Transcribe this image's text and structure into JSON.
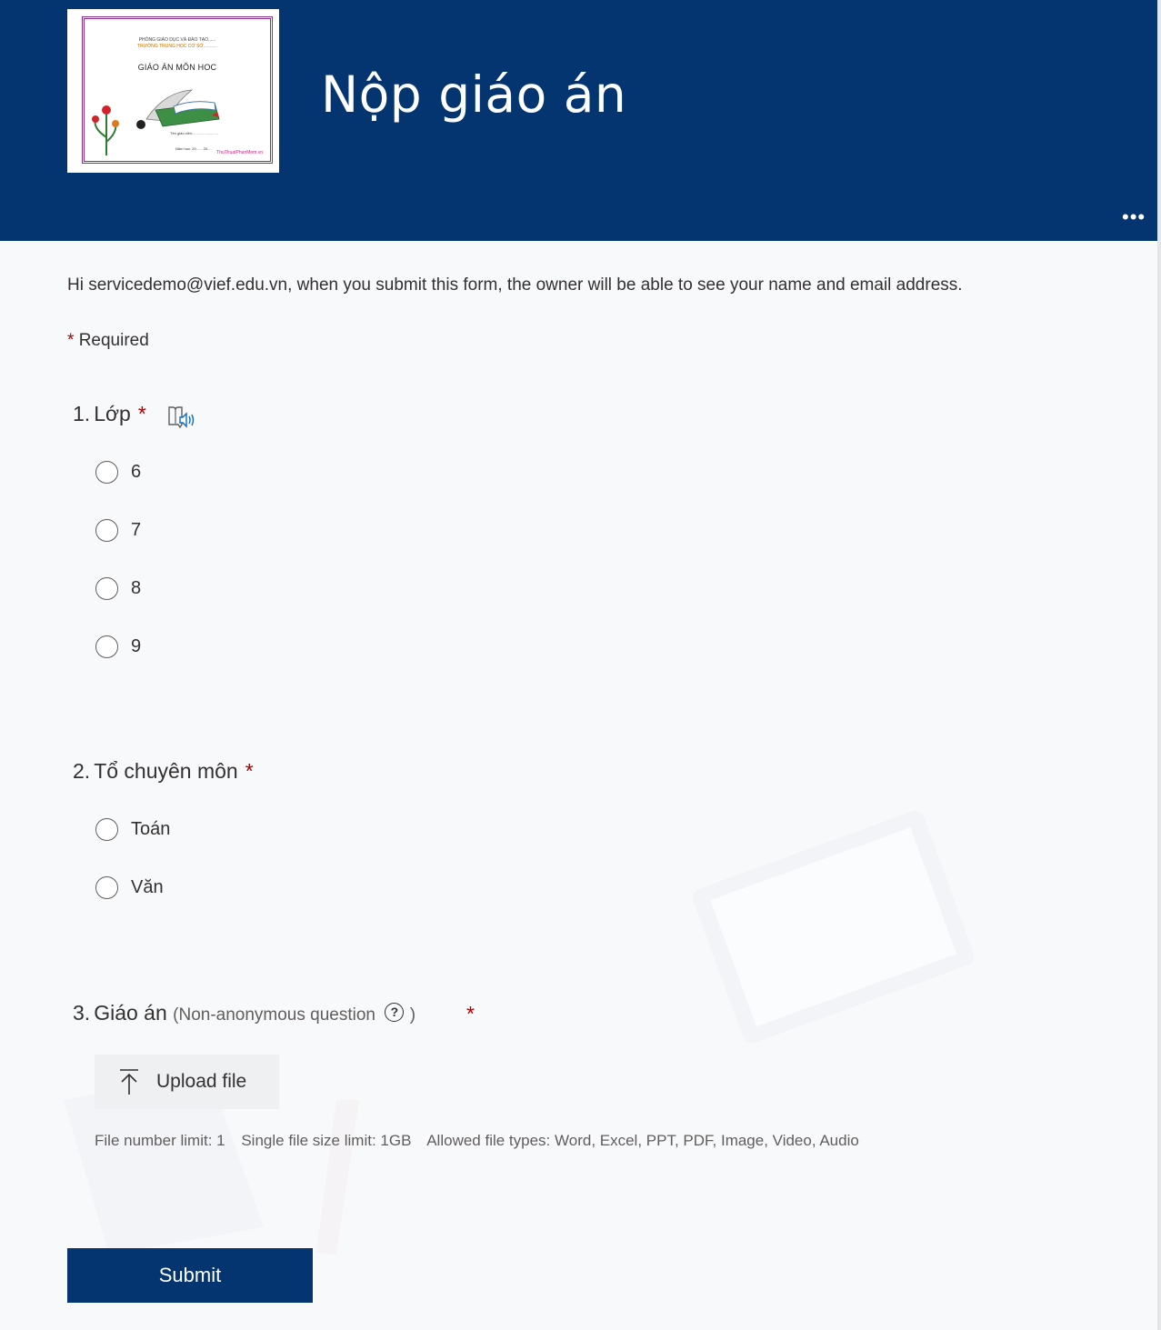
{
  "header": {
    "title": "Nộp giáo án",
    "more_icon": "more-horizontal-icon",
    "background": "#053570",
    "logo": {
      "line1": "PHÒNG GIÁO DỤC VÀ ĐÀO TẠO......",
      "line2": "TRƯỜNG TRUNG HỌC CƠ SỞ...........",
      "title": "GIÁO ÁN MÔN HOC",
      "teacher": "Tên giáo viên:.........................",
      "year": "Năm học: 20.... - 20....",
      "watermark": "ThuThuatPhanMem.vn"
    }
  },
  "notice": "Hi servicedemo@vief.edu.vn, when you submit this form, the owner will be able to see your name and email address.",
  "required_note": {
    "star": "*",
    "label": "Required"
  },
  "questions": [
    {
      "number": "1.",
      "title": "Lớp",
      "star": "*",
      "options": [
        "6",
        "7",
        "8",
        "9"
      ]
    },
    {
      "number": "2.",
      "title": "Tổ chuyên môn",
      "star": "*",
      "options": [
        "Toán",
        "Văn"
      ]
    },
    {
      "number": "3.",
      "title": "Giáo án",
      "note_open": "(Non-anonymous question",
      "help": "?",
      "note_close": ")",
      "star": "*",
      "upload_label": "Upload file",
      "limits": {
        "count": "File number limit: 1",
        "size": "Single file size limit: 1GB",
        "types": "Allowed file types: Word, Excel, PPT, PDF, Image, Video, Audio"
      }
    }
  ],
  "submit_label": "Submit",
  "colors": {
    "accent": "#053570",
    "required": "#a80000"
  }
}
